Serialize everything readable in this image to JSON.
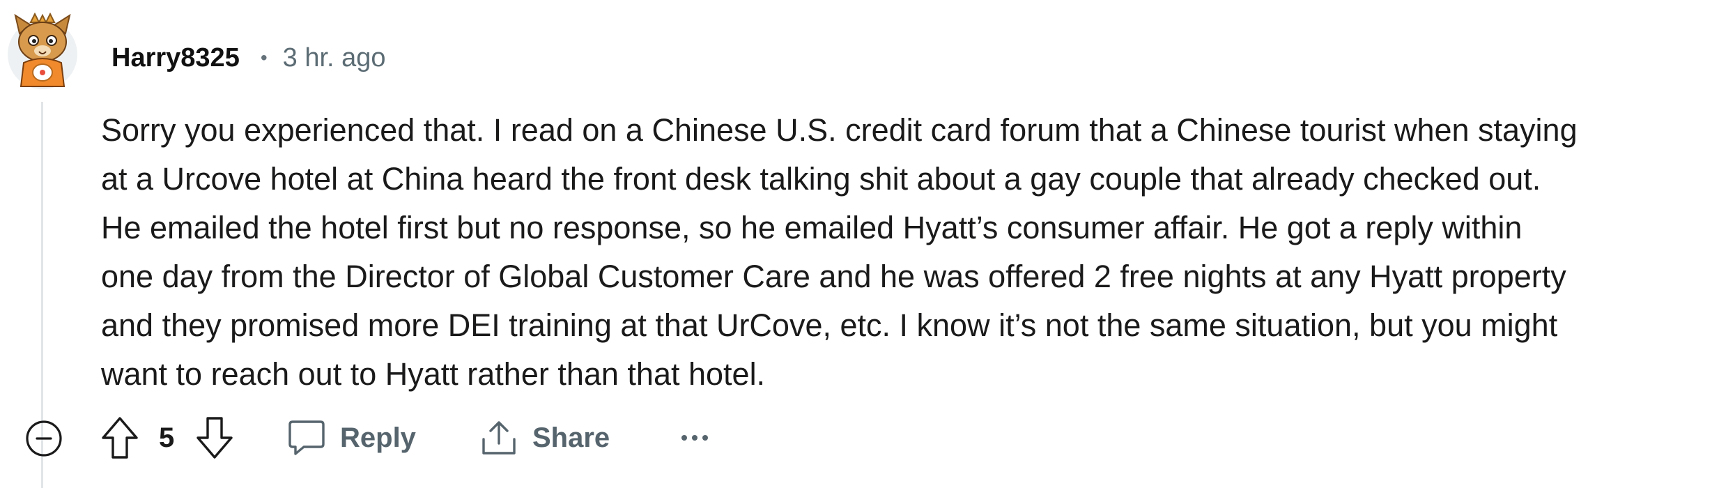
{
  "comment": {
    "author": "Harry8325",
    "separator": "•",
    "timestamp": "3 hr. ago",
    "body_lines": [
      "Sorry you experienced that. I read on a Chinese U.S. credit card forum that a Chinese tourist when staying",
      "at a Urcove hotel at China heard the front desk talking shit about a gay couple that already checked out.",
      "He emailed the hotel first but no response, so he emailed Hyatt’s consumer affair. He got a reply within",
      "one day from the Director of Global Customer Care and he was offered 2 free nights at any Hyatt property",
      "and they promised more DEI training at that UrCove, etc. I know it’s not the same situation, but you might",
      "want to reach out to Hyatt rather than that hotel."
    ]
  },
  "actions": {
    "vote_count": "5",
    "reply_label": "Reply",
    "share_label": "Share"
  },
  "icons": {
    "collapse": "collapse-minus-icon",
    "upvote": "upvote-arrow-icon",
    "downvote": "downvote-arrow-icon",
    "reply": "speech-bubble-icon",
    "share": "share-upload-icon",
    "more": "more-dots-icon"
  },
  "colors": {
    "text": "#1a1a1b",
    "meta": "#5c6c74",
    "action": "#56646d",
    "thread_line": "#e2e5e7"
  }
}
